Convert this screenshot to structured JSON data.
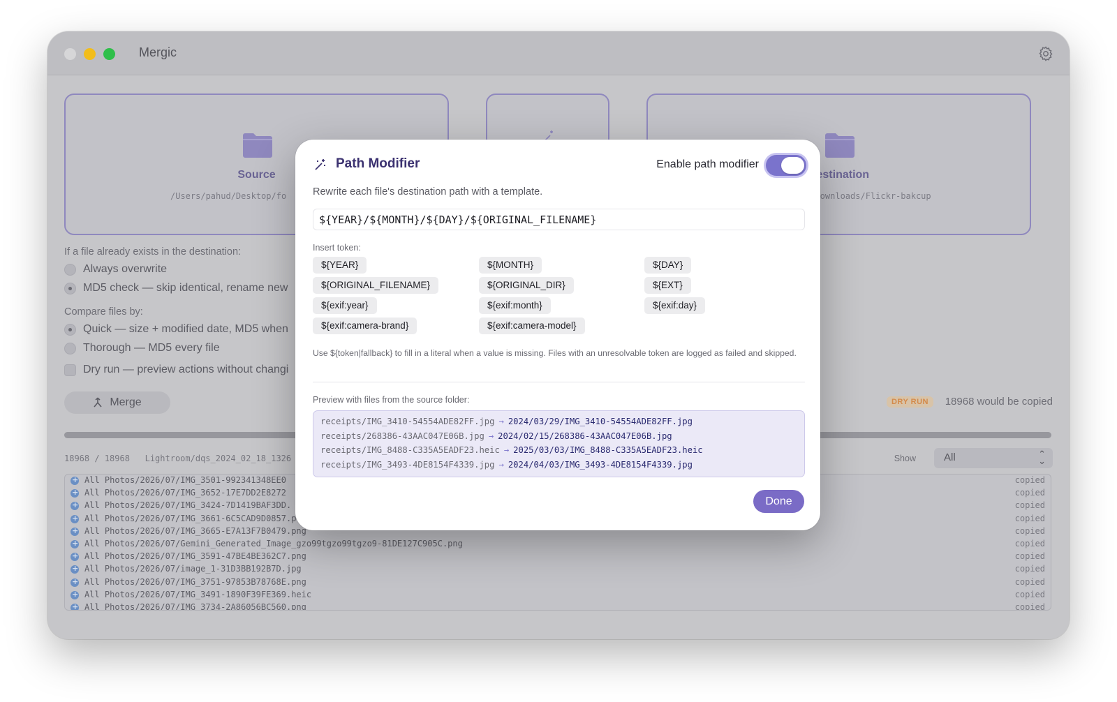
{
  "app": {
    "title": "Mergic"
  },
  "colors": {
    "accent": "#7a6bc6",
    "toggle_on": "#7a73cc",
    "dry_run_badge": "#d48a4a"
  },
  "cards": {
    "source": {
      "label": "Source",
      "path": "/Users/pahud/Desktop/fo"
    },
    "middle": {
      "icon": "magic-wand-icon"
    },
    "destination": {
      "label": "Destination",
      "path": "d/Downloads/Flickr-bakcup"
    }
  },
  "options": {
    "exists_label": "If a file already exists in the destination:",
    "exists_choices": [
      {
        "label": "Always overwrite",
        "selected": false
      },
      {
        "label": "MD5 check — skip identical, rename new",
        "selected": true
      }
    ],
    "compare_label": "Compare files by:",
    "compare_choices": [
      {
        "label": "Quick — size + modified date, MD5 when",
        "selected": true
      },
      {
        "label": "Thorough — MD5 every file",
        "selected": false
      }
    ],
    "dry_run_label": "Dry run — preview actions without changi",
    "dry_run_checked": false
  },
  "merge": {
    "label": "Merge",
    "badge": "DRY RUN",
    "summary": "18968 would be copied"
  },
  "progress": {
    "fraction": 1.0
  },
  "status": {
    "counter": "18968 / 18968",
    "current": "Lightroom/dqs_2024_02_18_1326"
  },
  "filter": {
    "label": "Show",
    "value": "All"
  },
  "log": [
    {
      "file": "All Photos/2026/07/IMG_3501-992341348EE0",
      "status": "copied"
    },
    {
      "file": "All Photos/2026/07/IMG_3652-17E7DD2E8272",
      "status": "copied"
    },
    {
      "file": "All Photos/2026/07/IMG_3424-7D1419BAF3DD.",
      "status": "copied"
    },
    {
      "file": "All Photos/2026/07/IMG_3661-6C5CAD9D0857.p",
      "status": "copied"
    },
    {
      "file": "All Photos/2026/07/IMG_3665-E7A13F7B0479.png",
      "status": "copied"
    },
    {
      "file": "All Photos/2026/07/Gemini_Generated_Image_gzo99tgzo99tgzo9-81DE127C905C.png",
      "status": "copied"
    },
    {
      "file": "All Photos/2026/07/IMG_3591-47BE4BE362C7.png",
      "status": "copied"
    },
    {
      "file": "All Photos/2026/07/image_1-31D3BB192B7D.jpg",
      "status": "copied"
    },
    {
      "file": "All Photos/2026/07/IMG_3751-97853B78768E.png",
      "status": "copied"
    },
    {
      "file": "All Photos/2026/07/IMG_3491-1890F39FE369.heic",
      "status": "copied"
    },
    {
      "file": "All Photos/2026/07/IMG_3734-2A86056BC560.png",
      "status": "copied"
    }
  ],
  "modal": {
    "title": "Path Modifier",
    "icon": "magic-wand-icon",
    "enable_label": "Enable path modifier",
    "enabled": true,
    "description": "Rewrite each file's destination path with a template.",
    "template": "${YEAR}/${MONTH}/${DAY}/${ORIGINAL_FILENAME}",
    "insert_label": "Insert token:",
    "tokens": [
      [
        "${YEAR}",
        "${MONTH}",
        "${DAY}"
      ],
      [
        "${ORIGINAL_FILENAME}",
        "${ORIGINAL_DIR}",
        "${EXT}"
      ],
      [
        "${exif:year}",
        "${exif:month}",
        "${exif:day}"
      ],
      [
        "${exif:camera-brand}",
        "${exif:camera-model}"
      ]
    ],
    "help": "Use ${token|fallback} to fill in a literal when a value is missing. Files with an unresolvable token are logged as failed and skipped.",
    "preview_label": "Preview with files from the source folder:",
    "preview": [
      {
        "src": "receipts/IMG_3410-54554ADE82FF.jpg",
        "dst": "2024/03/29/IMG_3410-54554ADE82FF.jpg"
      },
      {
        "src": "receipts/268386-43AAC047E06B.jpg",
        "dst": "2024/02/15/268386-43AAC047E06B.jpg"
      },
      {
        "src": "receipts/IMG_8488-C335A5EADF23.heic",
        "dst": "2025/03/03/IMG_8488-C335A5EADF23.heic"
      },
      {
        "src": "receipts/IMG_3493-4DE8154F4339.jpg",
        "dst": "2024/04/03/IMG_3493-4DE8154F4339.jpg"
      }
    ],
    "arrow": "→",
    "done_label": "Done"
  }
}
